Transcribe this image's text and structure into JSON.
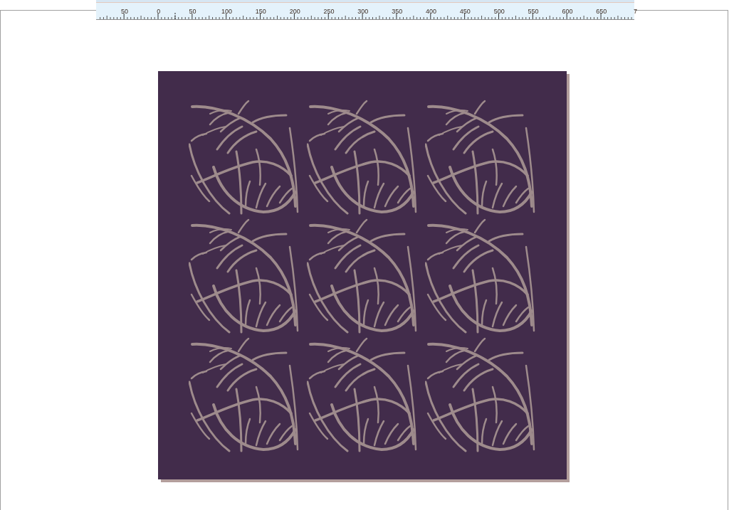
{
  "ruler": {
    "labels": [
      "50",
      "0",
      "50",
      "100",
      "150",
      "200",
      "250",
      "300",
      "350",
      "400",
      "450",
      "500",
      "550",
      "600",
      "650",
      "7"
    ]
  }
}
